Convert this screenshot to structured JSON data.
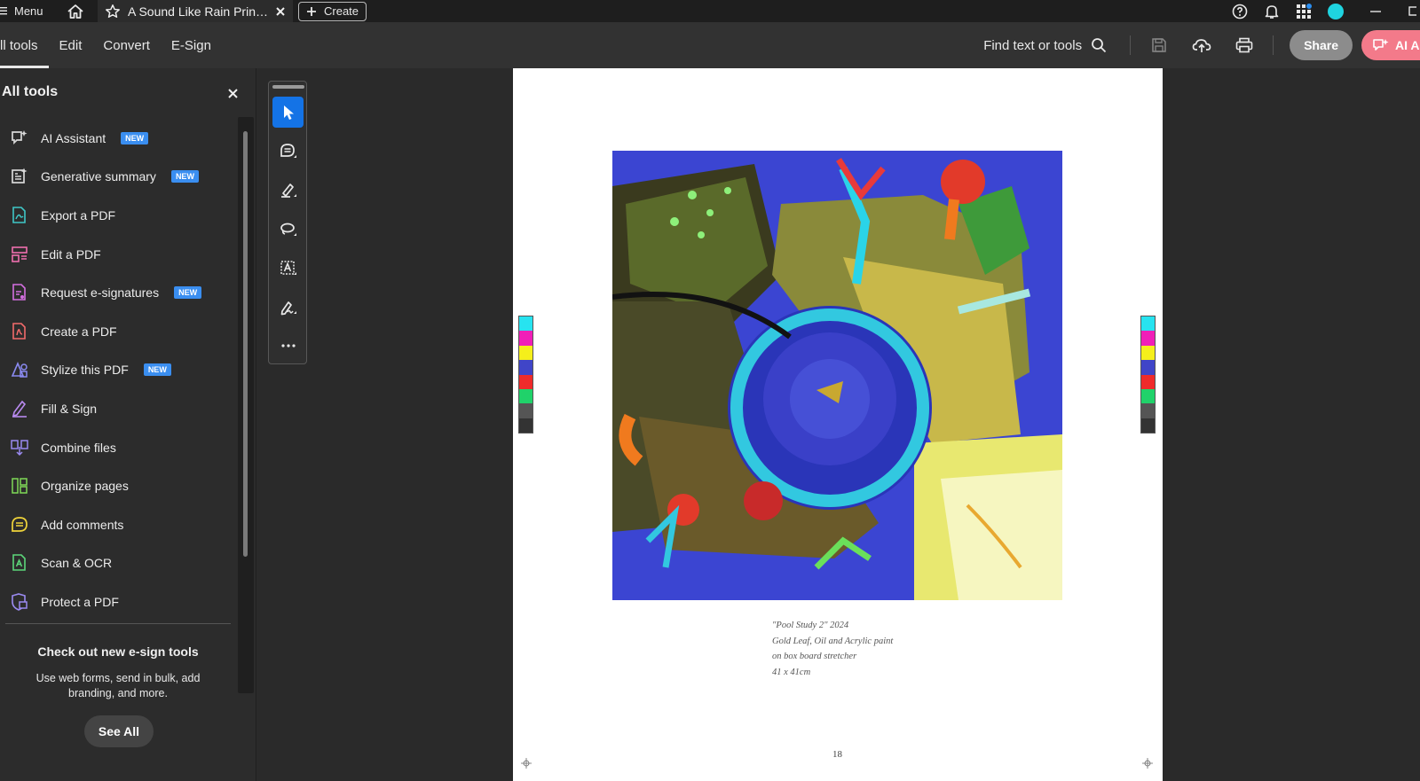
{
  "titlebar": {
    "menu_label": "Menu",
    "doc_tab_title": "A Sound Like Rain Print ...",
    "create_label": "Create"
  },
  "toolbar": {
    "tabs": [
      {
        "label": "ll tools",
        "active": true
      },
      {
        "label": "Edit",
        "active": false
      },
      {
        "label": "Convert",
        "active": false
      },
      {
        "label": "E-Sign",
        "active": false
      }
    ],
    "find_label": "Find text or tools",
    "share_label": "Share",
    "ai_label": "AI A"
  },
  "tools_panel": {
    "title": "All tools",
    "items": [
      {
        "label": "AI Assistant",
        "badge": "NEW",
        "icon": "ai-assistant-icon",
        "color": "#d8d8d8"
      },
      {
        "label": "Generative summary",
        "badge": "NEW",
        "icon": "generative-summary-icon",
        "color": "#d8d8d8"
      },
      {
        "label": "Export a PDF",
        "badge": "",
        "icon": "export-pdf-icon",
        "color": "#3fc6c6"
      },
      {
        "label": "Edit a PDF",
        "badge": "",
        "icon": "edit-pdf-icon",
        "color": "#ef6fae"
      },
      {
        "label": "Request e-signatures",
        "badge": "NEW",
        "icon": "request-esignatures-icon",
        "color": "#d46fe0"
      },
      {
        "label": "Create a PDF",
        "badge": "",
        "icon": "create-pdf-icon",
        "color": "#f26b6b"
      },
      {
        "label": "Stylize this PDF",
        "badge": "NEW",
        "icon": "stylize-pdf-icon",
        "color": "#8a8af0"
      },
      {
        "label": "Fill & Sign",
        "badge": "",
        "icon": "fill-sign-icon",
        "color": "#b98af0"
      },
      {
        "label": "Combine files",
        "badge": "",
        "icon": "combine-files-icon",
        "color": "#9a8af0"
      },
      {
        "label": "Organize pages",
        "badge": "",
        "icon": "organize-pages-icon",
        "color": "#7ed957"
      },
      {
        "label": "Add comments",
        "badge": "",
        "icon": "add-comments-icon",
        "color": "#f0d43a"
      },
      {
        "label": "Scan & OCR",
        "badge": "",
        "icon": "scan-ocr-icon",
        "color": "#5cd67a"
      },
      {
        "label": "Protect a PDF",
        "badge": "",
        "icon": "protect-pdf-icon",
        "color": "#9a8af0"
      }
    ],
    "promo_title": "Check out new e-sign tools",
    "promo_desc": "Use web forms, send in bulk, add branding, and more.",
    "see_all_label": "See All"
  },
  "quick_tools": [
    {
      "name": "select-tool",
      "icon": "pointer-icon",
      "active": true
    },
    {
      "name": "comment-tool",
      "icon": "comment-icon",
      "active": false
    },
    {
      "name": "highlight-tool",
      "icon": "highlighter-icon",
      "active": false
    },
    {
      "name": "draw-tool",
      "icon": "lasso-icon",
      "active": false
    },
    {
      "name": "text-tool",
      "icon": "text-box-icon",
      "active": false
    },
    {
      "name": "sign-tool",
      "icon": "sign-icon",
      "active": false
    },
    {
      "name": "more-tools",
      "icon": "more-icon",
      "active": false
    }
  ],
  "document": {
    "caption_lines": [
      "\"Pool Study 2\" 2024",
      "Gold Leaf, Oil and Acrylic paint",
      "on box board stretcher",
      "41 x 41cm"
    ],
    "page_number": "18",
    "color_bar_left": [
      "#27e3f0",
      "#f01fb8",
      "#f5ef1b",
      "#4045c8",
      "#ef2b2b",
      "#20d26a",
      "#555555",
      "#333333"
    ],
    "color_bar_right": [
      "#27e3f0",
      "#f01fb8",
      "#f5ef1b",
      "#4045c8",
      "#ef2b2b",
      "#20d26a",
      "#555555",
      "#333333"
    ]
  },
  "colors": {
    "accent": "#1473e6",
    "badge": "#3a8ef0",
    "ai_button": "#f37a8a"
  }
}
